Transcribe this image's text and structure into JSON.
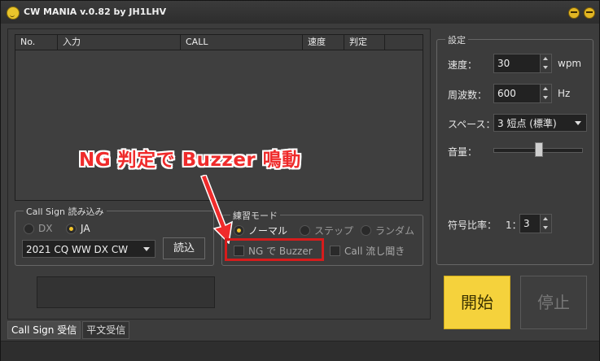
{
  "app": {
    "title": "CW MANIA v.0.82 by JH1LHV"
  },
  "grid": {
    "columns": [
      "No.",
      "入力",
      "CALL",
      "速度",
      "判定"
    ]
  },
  "callsign": {
    "group_label": "Call Sign 読み込み",
    "radio_dx": "DX",
    "radio_ja": "JA",
    "selected": "JA",
    "contest": "2021 CQ WW DX CW",
    "load_button": "読込"
  },
  "practice": {
    "group_label": "練習モード",
    "mode_normal": "ノーマル",
    "mode_step": "ステップ",
    "mode_random": "ランダム",
    "selected": "ノーマル",
    "ng_buzzer": "NG で Buzzer",
    "call_listen": "Call 流し聞き"
  },
  "settings": {
    "group_label": "設定",
    "speed_label": "速度：",
    "speed_value": "30",
    "speed_unit": "wpm",
    "freq_label": "周波数：",
    "freq_value": "600",
    "freq_unit": "Hz",
    "space_label": "スペース：",
    "space_value": "3 短点 (標準)",
    "volume_label": "音量：",
    "volume_level": 0.55,
    "ratio_label": "符号比率：",
    "ratio_prefix": "1：",
    "ratio_value": "3"
  },
  "controls": {
    "start": "開始",
    "stop": "停止"
  },
  "tabs": [
    "Call Sign 受信",
    "平文受信"
  ],
  "annotation": {
    "text": "NG 判定で Buzzer  鳴動"
  },
  "colors": {
    "accent": "#f5d23c",
    "annotation": "#ef2b2b"
  }
}
